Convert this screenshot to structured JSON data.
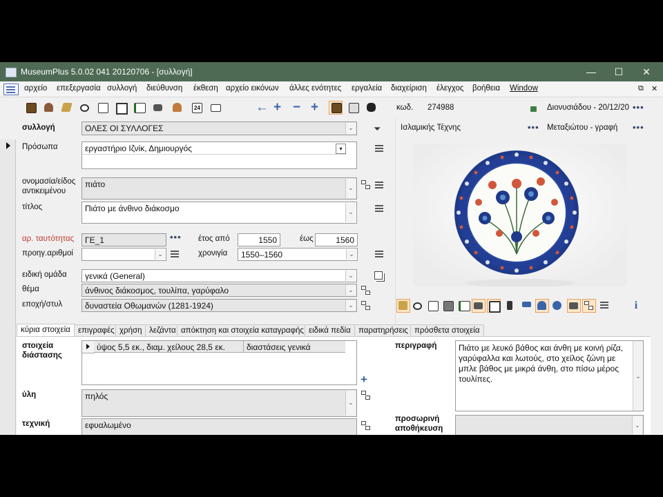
{
  "window": {
    "title": "MuseumPlus 5.0.02 041 20120706 - [συλλογή]",
    "minimize": "—",
    "maximize": "☐",
    "close": "✕"
  },
  "menu": {
    "items": [
      "αρχείο",
      "επεξεργασία",
      "συλλογή",
      "διεύθυνση",
      "έκθεση",
      "αρχείο εικόνων",
      "άλλες ενότητες",
      "εργαλεία",
      "διαχείριση",
      "έλεγχος",
      "βοήθεια",
      "Window"
    ],
    "restore_glyph": "⧉",
    "close_glyph": "✕"
  },
  "toolbar": {
    "icons": [
      "book-icon",
      "person-icon",
      "books-icon",
      "eye-icon",
      "document-icon",
      "house-icon",
      "checklist-icon",
      "camera-icon",
      "group-icon",
      "calendar-icon",
      "mail-icon"
    ],
    "calendar_text": "24",
    "nav": [
      "←",
      "+",
      "−",
      "+"
    ],
    "code_label": "κωδ.",
    "code_value": "274988",
    "user_date": "Διονυσιάδου - 20/12/20",
    "more": "•••"
  },
  "record": {
    "collection_label": "συλλογή",
    "collection_value": "ΟΛΕΣ ΟΙ ΣΥΛΛΟΓΕΣ",
    "dept": "Ισλαμικής Τέχνης",
    "author": "Μεταξιώτου - γραφή",
    "persons_label": "Πρόσωπα",
    "persons_value": "εργαστήριο  Ιζνίκ, Δημιουργός",
    "name_label_1": "ονομασία/είδος",
    "name_label_2": "αντικειμένου",
    "name_value": "πιάτο",
    "title_label": "τίτλος",
    "title_value": "Πιάτο με άνθινο διάκοσμο",
    "id_label": "αρ. ταυτότητας",
    "id_value": "ΓΕ_1",
    "year_from_label": "έτος από",
    "year_from": "1550",
    "year_to_label": "έως",
    "year_to": "1560",
    "prev_label": "προηγ.αριθμοί",
    "prev_value": "",
    "chrono_label": "χρονιγία",
    "chrono_value": "1550–1560",
    "group_label": "ειδική ομάδα",
    "group_value": "γενικά (General)",
    "theme_label": "θέμα",
    "theme_value": "άνθινος διάκοσμος, τουλίπα, γαρύφαλο",
    "era_label": "εποχή/στυλ",
    "era_value": "δυναστεία Οθωμανών (1281-1924)"
  },
  "tabs": [
    "κύρια στοιχεία",
    "επιγραφές",
    "χρήση",
    "λεζάντα",
    "απόκτηση και στοιχεία καταγραφής",
    "ειδικά πεδία",
    "παρατηρήσεις",
    "πρόσθετα στοιχεία"
  ],
  "main": {
    "dim_label_1": "στοιχεία",
    "dim_label_2": "διάστασης",
    "dim_value": "ύψος 5,5 εκ., διαμ. χείλους 28,5 εκ.",
    "dim_type": "διαστάσεις γενικά",
    "material_label": "ύλη",
    "material_value": "πηλός",
    "technique_label": "τεχνική",
    "technique_value": "εφυαλωμένο",
    "desc_label": "περιγραφή",
    "desc_value": "Πιάτο με λευκό βάθος και άνθη με κοινή ρίζα, γαρύφαλλα και λωτούς, στο χείλος ζώνη με μπλε βάθος με μικρά άνθη, στο πίσω μέρος τουλίπες.",
    "storage_label_1": "προσωρινή",
    "storage_label_2": "αποθήκευση",
    "storage_value": ""
  },
  "image_toolbar": [
    "books-icon",
    "eye-icon",
    "document-icon",
    "box-icon",
    "checklist-icon",
    "camera-icon",
    "house-icon",
    "ruler-icon",
    "flag-icon",
    "tag-icon",
    "eye-circle-icon",
    "tree-icon",
    "list-icon",
    "info-icon"
  ],
  "colors": {
    "titlebar": "#4e6a54",
    "accent_blue": "#3a64a8",
    "plate_blue": "#1f3a8a",
    "plate_red": "#d0573a"
  }
}
